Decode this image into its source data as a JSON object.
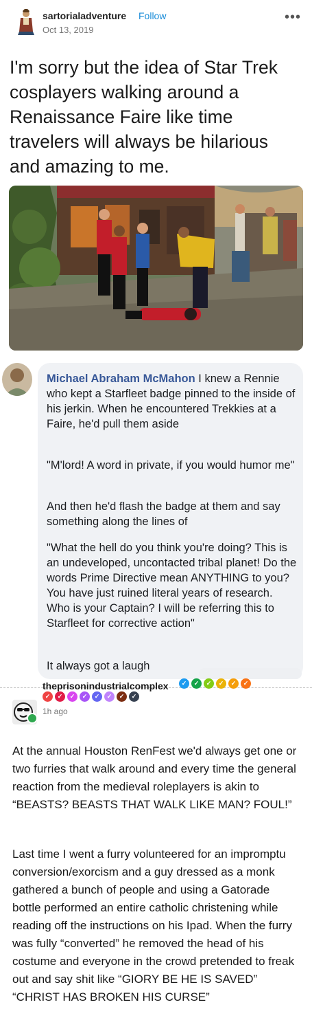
{
  "post": {
    "username": "sartorialadventure",
    "follow_label": "Follow",
    "date": "Oct 13, 2019",
    "more_label": "•••",
    "text": "I'm sorry but the idea of Star Trek cosplayers walking around a Renaissance Faire like time travelers will always be hilarious and amazing to me."
  },
  "comment": {
    "name": "Michael Abraham McMahon",
    "paragraphs": [
      "I knew a Rennie who kept a Starfleet badge pinned to the inside of his jerkin. When he encountered Trekkies at a Faire, he'd pull them aside",
      "\"M'lord! A word in private, if you would humor me\"",
      "And then he'd flash the badge at them and say something along the lines of",
      "\"What the hell do you think you're doing? This is an undeveloped, uncontacted tribal planet! Do the words Prime Directive mean ANYTHING to you? You have just ruined literal years of research. Who is your Captain? I will be referring this to Starfleet for corrective action\"",
      "It always got a laugh"
    ]
  },
  "reblog": {
    "username": "theprisonindustrialcomplex",
    "time": "1h ago",
    "badge_colors_row1": [
      "#1d9bf0",
      "#16a34a",
      "#84cc16",
      "#eab308",
      "#f59e0b",
      "#f97316"
    ],
    "badge_colors_row2": [
      "#ef4444",
      "#e11d48",
      "#d946ef",
      "#a855f7",
      "#6366f1",
      "#c084fc",
      "#7c2d12",
      "#374151"
    ],
    "paragraphs": [
      "At the annual Houston RenFest we'd always get one or two furries that walk around and every time the general reaction from the medieval roleplayers is akin to “BEASTS? BEASTS THAT WALK LIKE MAN? FOUL!”",
      "Last time I went a furry volunteered for an impromptu conversion/exorcism and a guy dressed as a monk gathered a bunch of people and using a Gatorade bottle performed an entire catholic christening while reading off the instructions on his Ipad. When the furry was fully “converted” he removed the head of his costume and everyone in the crowd pretended to freak out and say shit like “GIORY BE HE IS SAVED” “CHRIST HAS BROKEN HIS CURSE”"
    ]
  }
}
